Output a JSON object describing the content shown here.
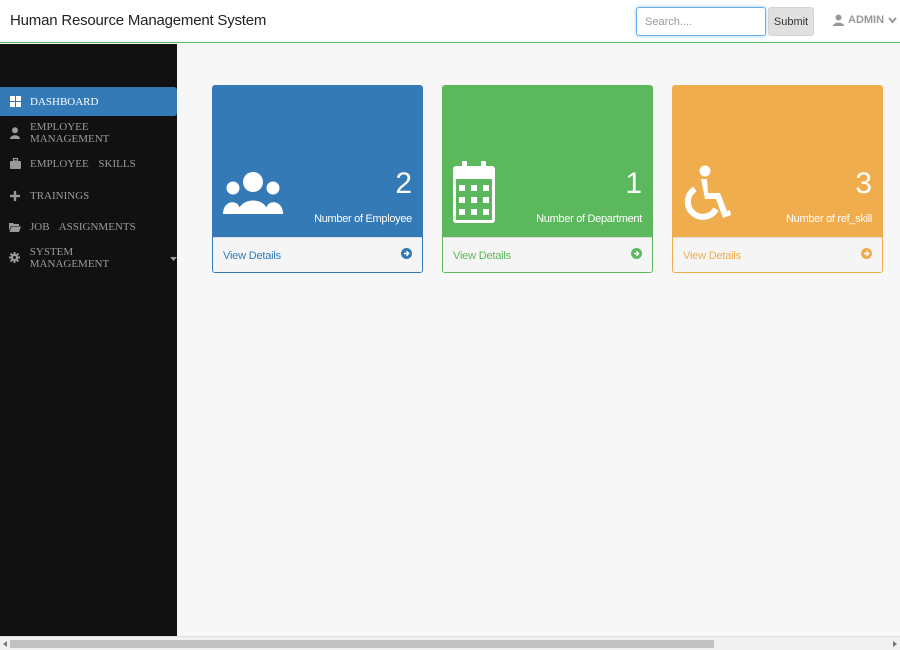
{
  "header": {
    "brand": "Human Resource Management System",
    "search_placeholder": "Search....",
    "search_value": "",
    "submit_label": "Submit",
    "user_label": "ADMIN"
  },
  "sidebar": {
    "items": [
      {
        "label": "DASHBOARD",
        "icon": "dashboard-icon",
        "active": true
      },
      {
        "label": "EMPLOYEE MANAGEMENT",
        "icon": "user-icon",
        "active": false
      },
      {
        "label": "EMPLOYEE SKILLS",
        "icon": "briefcase-icon",
        "active": false
      },
      {
        "label": "TRAININGS",
        "icon": "plus-icon",
        "active": false
      },
      {
        "label": "JOB ASSIGNMENTS",
        "icon": "folder-open-icon",
        "active": false
      },
      {
        "label": "SYSTEM MANAGEMENT",
        "icon": "gear-icon",
        "active": false,
        "has_dropdown": true
      }
    ]
  },
  "panels": [
    {
      "count": "2",
      "caption": "Number of Employee",
      "footer": "View Details",
      "icon": "users-icon",
      "color": "#337ab7"
    },
    {
      "count": "1",
      "caption": "Number of Department",
      "footer": "View Details",
      "icon": "calendar-icon",
      "color": "#5cb85c"
    },
    {
      "count": "3",
      "caption": "Number of ref_skill",
      "footer": "View Details",
      "icon": "wheelchair-icon",
      "color": "#f0ad4e"
    }
  ],
  "colors": {
    "primary": "#337ab7",
    "success": "#5cb85c",
    "warning": "#f0ad4e",
    "sidebar_bg": "#111111"
  }
}
